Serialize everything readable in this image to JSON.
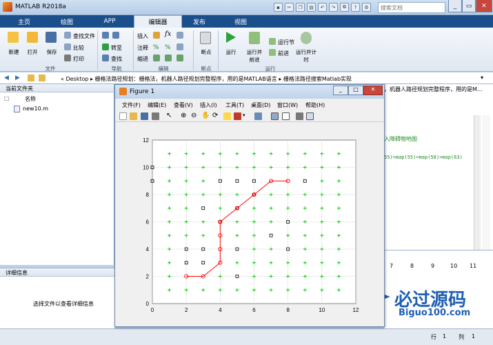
{
  "window": {
    "title": "MATLAB R2018a",
    "search_placeholder": "搜索文档"
  },
  "tabs": [
    "主页",
    "绘图",
    "APP",
    "编辑器",
    "发布",
    "视图"
  ],
  "ribbon": {
    "file_buttons": [
      "新建",
      "打开",
      "保存"
    ],
    "file_small": [
      "查找文件",
      "比较",
      "打印"
    ],
    "nav_small": [
      "转至",
      "查找"
    ],
    "nav_top": "插入",
    "edit_small": [
      "注释",
      "缩进"
    ],
    "fx": "fx",
    "breakpoint": "断点",
    "run": [
      "运行",
      "运行并前进",
      "运行节",
      "前进",
      "运行并计时"
    ],
    "groups": [
      "文件",
      "导航",
      "编辑",
      "断点",
      "运行"
    ]
  },
  "address": {
    "path": "« Desktop ▸ 栅格法路径规划：栅格法，机器人路径规划完整程序，用的是MATLAB语言 ▸ 栅格法路径搜索Matlab实现"
  },
  "left_panel": {
    "title": "当前文件夹",
    "column": "名称",
    "file": "new10.m"
  },
  "detail_panel": {
    "title": "详细信息",
    "hint": "选择文件以查看详细信息"
  },
  "editor_snippet": {
    "line1": "入障碍物地图",
    "line2": "55)=map(55)=map(58)=map(63)",
    "title_frag": "，机器人路径规划完整程序，用的是M..."
  },
  "ws_headers": [
    "7",
    "8",
    "9",
    "10",
    "11"
  ],
  "status": {
    "row_label": "行",
    "row": "1",
    "col_label": "列",
    "col": "1"
  },
  "figure": {
    "title": "Figure 1",
    "menu": [
      "文件(F)",
      "编辑(E)",
      "查看(V)",
      "插入(I)",
      "工具(T)",
      "桌面(D)",
      "窗口(W)",
      "帮助(H)"
    ]
  },
  "logo": {
    "text": "必过源码",
    "url": "Biguo100.com"
  },
  "colors": {
    "ribbon_tabs": "#1b4f8c",
    "path": "#ff0000",
    "free": "#00cc00",
    "obstacle": "#000000"
  },
  "chart_data": {
    "type": "scatter",
    "xlim": [
      0,
      12
    ],
    "ylim": [
      0,
      12
    ],
    "xticks": [
      0,
      2,
      4,
      6,
      8,
      10,
      12
    ],
    "yticks": [
      0,
      2,
      4,
      6,
      8,
      10,
      12
    ],
    "grid": true,
    "free_cells": "green '+' markers at every integer grid point (1..11) except obstacles and path",
    "obstacles": [
      [
        0,
        9
      ],
      [
        0,
        10
      ],
      [
        2,
        3
      ],
      [
        2,
        4
      ],
      [
        3,
        3
      ],
      [
        3,
        4
      ],
      [
        3,
        7
      ],
      [
        4,
        9
      ],
      [
        4,
        6
      ],
      [
        5,
        9
      ],
      [
        5,
        7
      ],
      [
        5,
        4
      ],
      [
        5,
        2
      ],
      [
        6,
        9
      ],
      [
        6,
        8
      ],
      [
        7,
        5
      ],
      [
        8,
        6
      ],
      [
        8,
        4
      ],
      [
        9,
        9
      ]
    ],
    "path": {
      "x": [
        2,
        3,
        4,
        4,
        4,
        4,
        5,
        6,
        7,
        8
      ],
      "y": [
        2,
        2,
        3,
        4,
        5,
        6,
        7,
        8,
        9,
        9
      ]
    }
  }
}
